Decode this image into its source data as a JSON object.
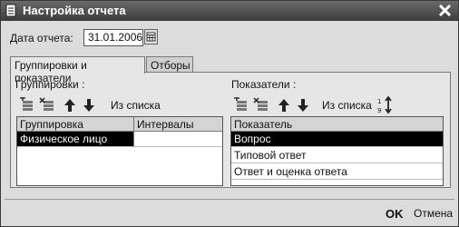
{
  "window": {
    "title": "Настройка отчета"
  },
  "date": {
    "label": "Дата отчета:",
    "value": "31.01.2006"
  },
  "tabs": [
    {
      "label": "Группировки и показатели",
      "active": true
    },
    {
      "label": "Отборы",
      "active": false
    }
  ],
  "groupings": {
    "label": "Группировки :",
    "from_list": "Из списка",
    "columns": [
      "Группировка",
      "Интервалы"
    ],
    "rows": [
      {
        "name": "Физическое лицо",
        "interval": ""
      }
    ]
  },
  "indicators": {
    "label": "Показатели :",
    "from_list": "Из списка",
    "column": "Показатель",
    "rows": [
      "Вопрос",
      "Типовой ответ",
      "Ответ и оценка ответа"
    ]
  },
  "footer": {
    "ok": "OK",
    "cancel": "Отмена"
  }
}
